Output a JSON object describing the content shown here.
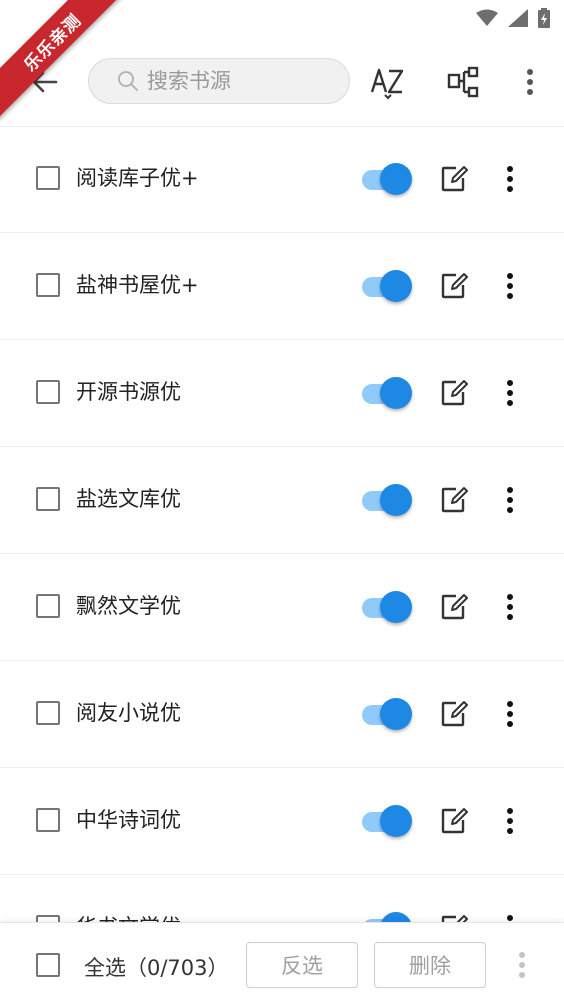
{
  "watermark": {
    "text": "乐乐亲测"
  },
  "toolbar": {
    "search_placeholder": "搜索书源"
  },
  "sources": [
    {
      "name": "阅读库子优+",
      "enabled": true
    },
    {
      "name": "盐神书屋优+",
      "enabled": true
    },
    {
      "name": "开源书源优",
      "enabled": true
    },
    {
      "name": "盐选文库优",
      "enabled": true
    },
    {
      "name": "飘然文学优",
      "enabled": true
    },
    {
      "name": "阅友小说优",
      "enabled": true
    },
    {
      "name": "中华诗词优",
      "enabled": true
    },
    {
      "name": "华书文学优",
      "enabled": true
    }
  ],
  "bottom_bar": {
    "select_all_label": "全选（0/703）",
    "invert_label": "反选",
    "delete_label": "删除"
  },
  "colors": {
    "accent": "#1e88e5",
    "accent_track": "#90caf9",
    "ribbon": "#c8282d"
  }
}
